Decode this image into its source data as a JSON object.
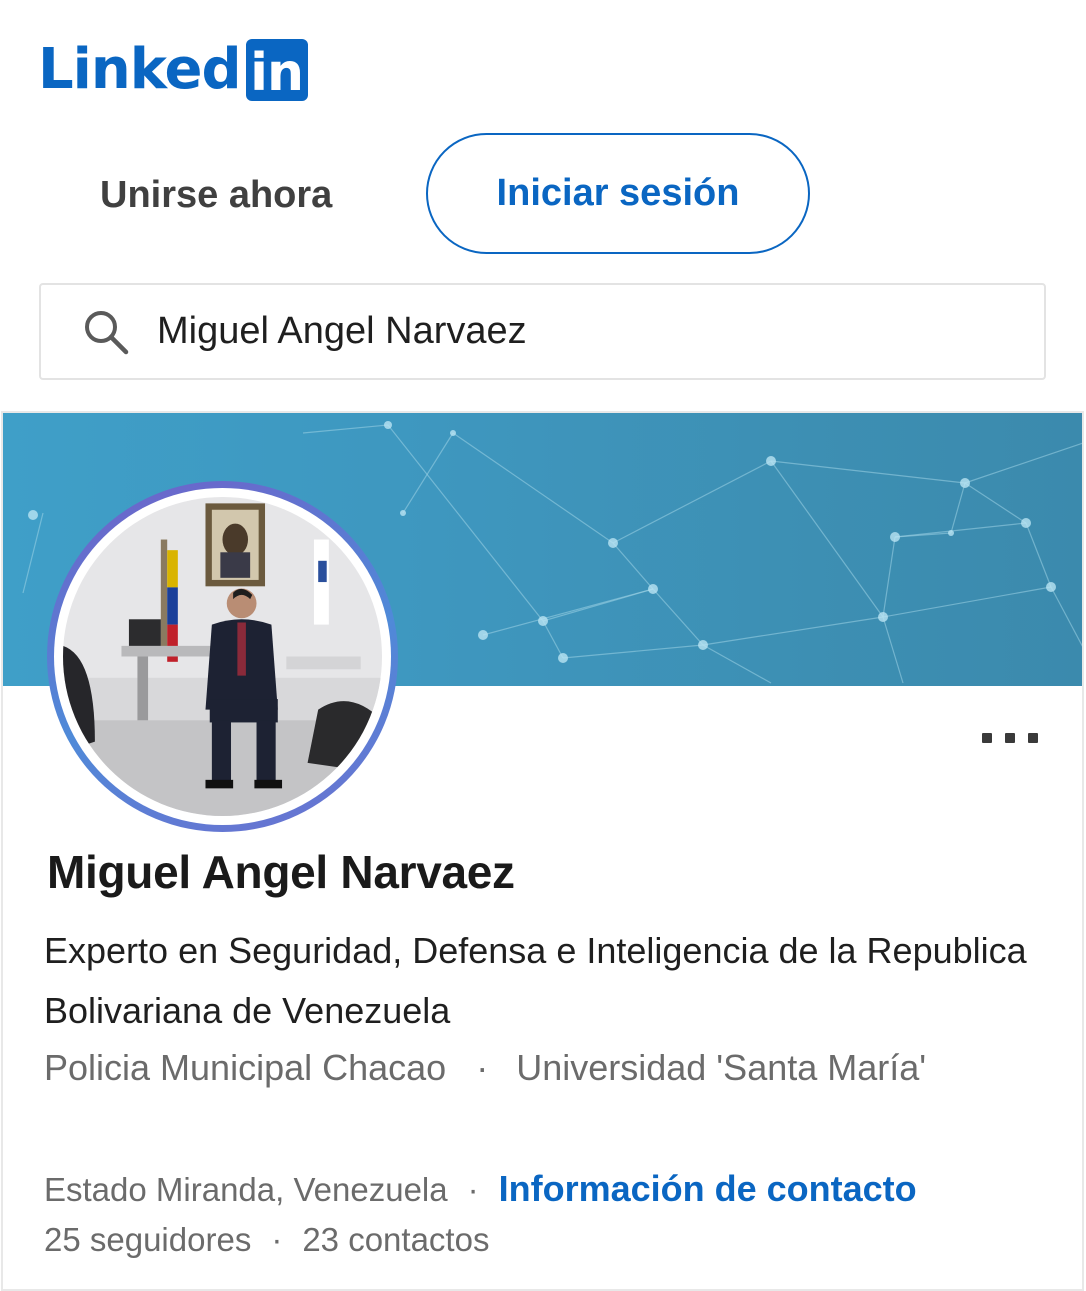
{
  "header": {
    "logo_word": "Linked",
    "logo_box": "in",
    "join_label": "Unirse ahora",
    "signin_label": "Iniciar sesión"
  },
  "search": {
    "value": "Miguel Angel Narvaez"
  },
  "profile": {
    "name": "Miguel Angel Narvaez",
    "headline": "Experto en Seguridad, Defensa e Inteligencia de la Republica Bolivariana de Venezuela",
    "company": "Policia Municipal Chacao",
    "school": "Universidad 'Santa María'",
    "location": "Estado Miranda, Venezuela",
    "contact_link": "Información de contacto",
    "followers": "25 seguidores",
    "connections": "23 contactos",
    "separator": "·"
  },
  "colors": {
    "brand": "#0a66c2",
    "banner": "#3e97bf"
  },
  "icons": {
    "search": "search-icon",
    "more": "more-options-icon"
  }
}
